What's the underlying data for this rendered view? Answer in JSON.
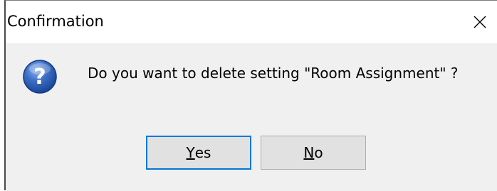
{
  "window": {
    "title": "Confirmation",
    "close_icon": "close-icon"
  },
  "message": {
    "icon": "question-icon",
    "text": "Do you want to delete setting \"Room Assignment\" ?"
  },
  "buttons": {
    "yes": {
      "mnemonic": "Y",
      "rest": "es"
    },
    "no": {
      "mnemonic": "N",
      "rest": "o"
    }
  },
  "colors": {
    "title_bg": "#ffffff",
    "body_bg": "#f0f0f0",
    "button_bg": "#e1e1e1",
    "default_border": "#0078d7",
    "icon_blue": "#2f62b8"
  }
}
